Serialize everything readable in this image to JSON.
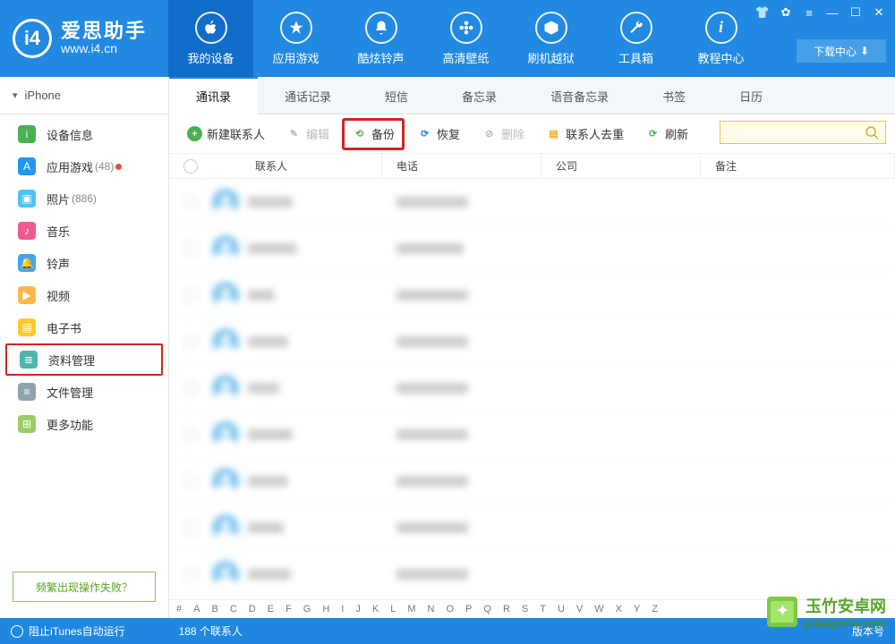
{
  "brand": {
    "title": "爱思助手",
    "url": "www.i4.cn"
  },
  "winbar": {
    "download": "下载中心"
  },
  "topnav": [
    {
      "label": "我的设备"
    },
    {
      "label": "应用游戏"
    },
    {
      "label": "酷炫铃声"
    },
    {
      "label": "高清壁纸"
    },
    {
      "label": "刷机越狱"
    },
    {
      "label": "工具箱"
    },
    {
      "label": "教程中心"
    }
  ],
  "device_selector": "iPhone",
  "sidebar": {
    "items": [
      {
        "label": "设备信息",
        "color": "#4caf50"
      },
      {
        "label": "应用游戏",
        "color": "#2196f3",
        "badge": "(48)",
        "dot": true
      },
      {
        "label": "照片",
        "color": "#4fc3f7",
        "badge": "(886)"
      },
      {
        "label": "音乐",
        "color": "#ef5b8a"
      },
      {
        "label": "铃声",
        "color": "#42a5f5"
      },
      {
        "label": "视频",
        "color": "#ffb74d"
      },
      {
        "label": "电子书",
        "color": "#ffca28"
      },
      {
        "label": "资料管理",
        "color": "#4db6ac"
      },
      {
        "label": "文件管理",
        "color": "#90a4ae"
      },
      {
        "label": "更多功能",
        "color": "#9ccc65"
      }
    ],
    "help": "频繁出现操作失败？"
  },
  "subtabs": [
    {
      "label": "通讯录"
    },
    {
      "label": "通话记录"
    },
    {
      "label": "短信"
    },
    {
      "label": "备忘录"
    },
    {
      "label": "语音备忘录"
    },
    {
      "label": "书签"
    },
    {
      "label": "日历"
    }
  ],
  "toolbar": {
    "add": "新建联系人",
    "edit": "编辑",
    "backup": "备份",
    "restore": "恢复",
    "delete": "删除",
    "dedup": "联系人去重",
    "refresh": "刷新"
  },
  "columns": {
    "name": "联系人",
    "phone": "电话",
    "company": "公司",
    "note": "备注"
  },
  "alpha": [
    "#",
    "A",
    "B",
    "C",
    "D",
    "E",
    "F",
    "G",
    "H",
    "I",
    "J",
    "K",
    "L",
    "M",
    "N",
    "O",
    "P",
    "Q",
    "R",
    "S",
    "T",
    "U",
    "V",
    "W",
    "X",
    "Y",
    "Z"
  ],
  "status": {
    "itunes": "阻止iTunes自动运行",
    "count": "188 个联系人",
    "version": "版本号"
  },
  "watermark": {
    "name": "玉竹安卓网",
    "site": "yzlangecha.com"
  }
}
